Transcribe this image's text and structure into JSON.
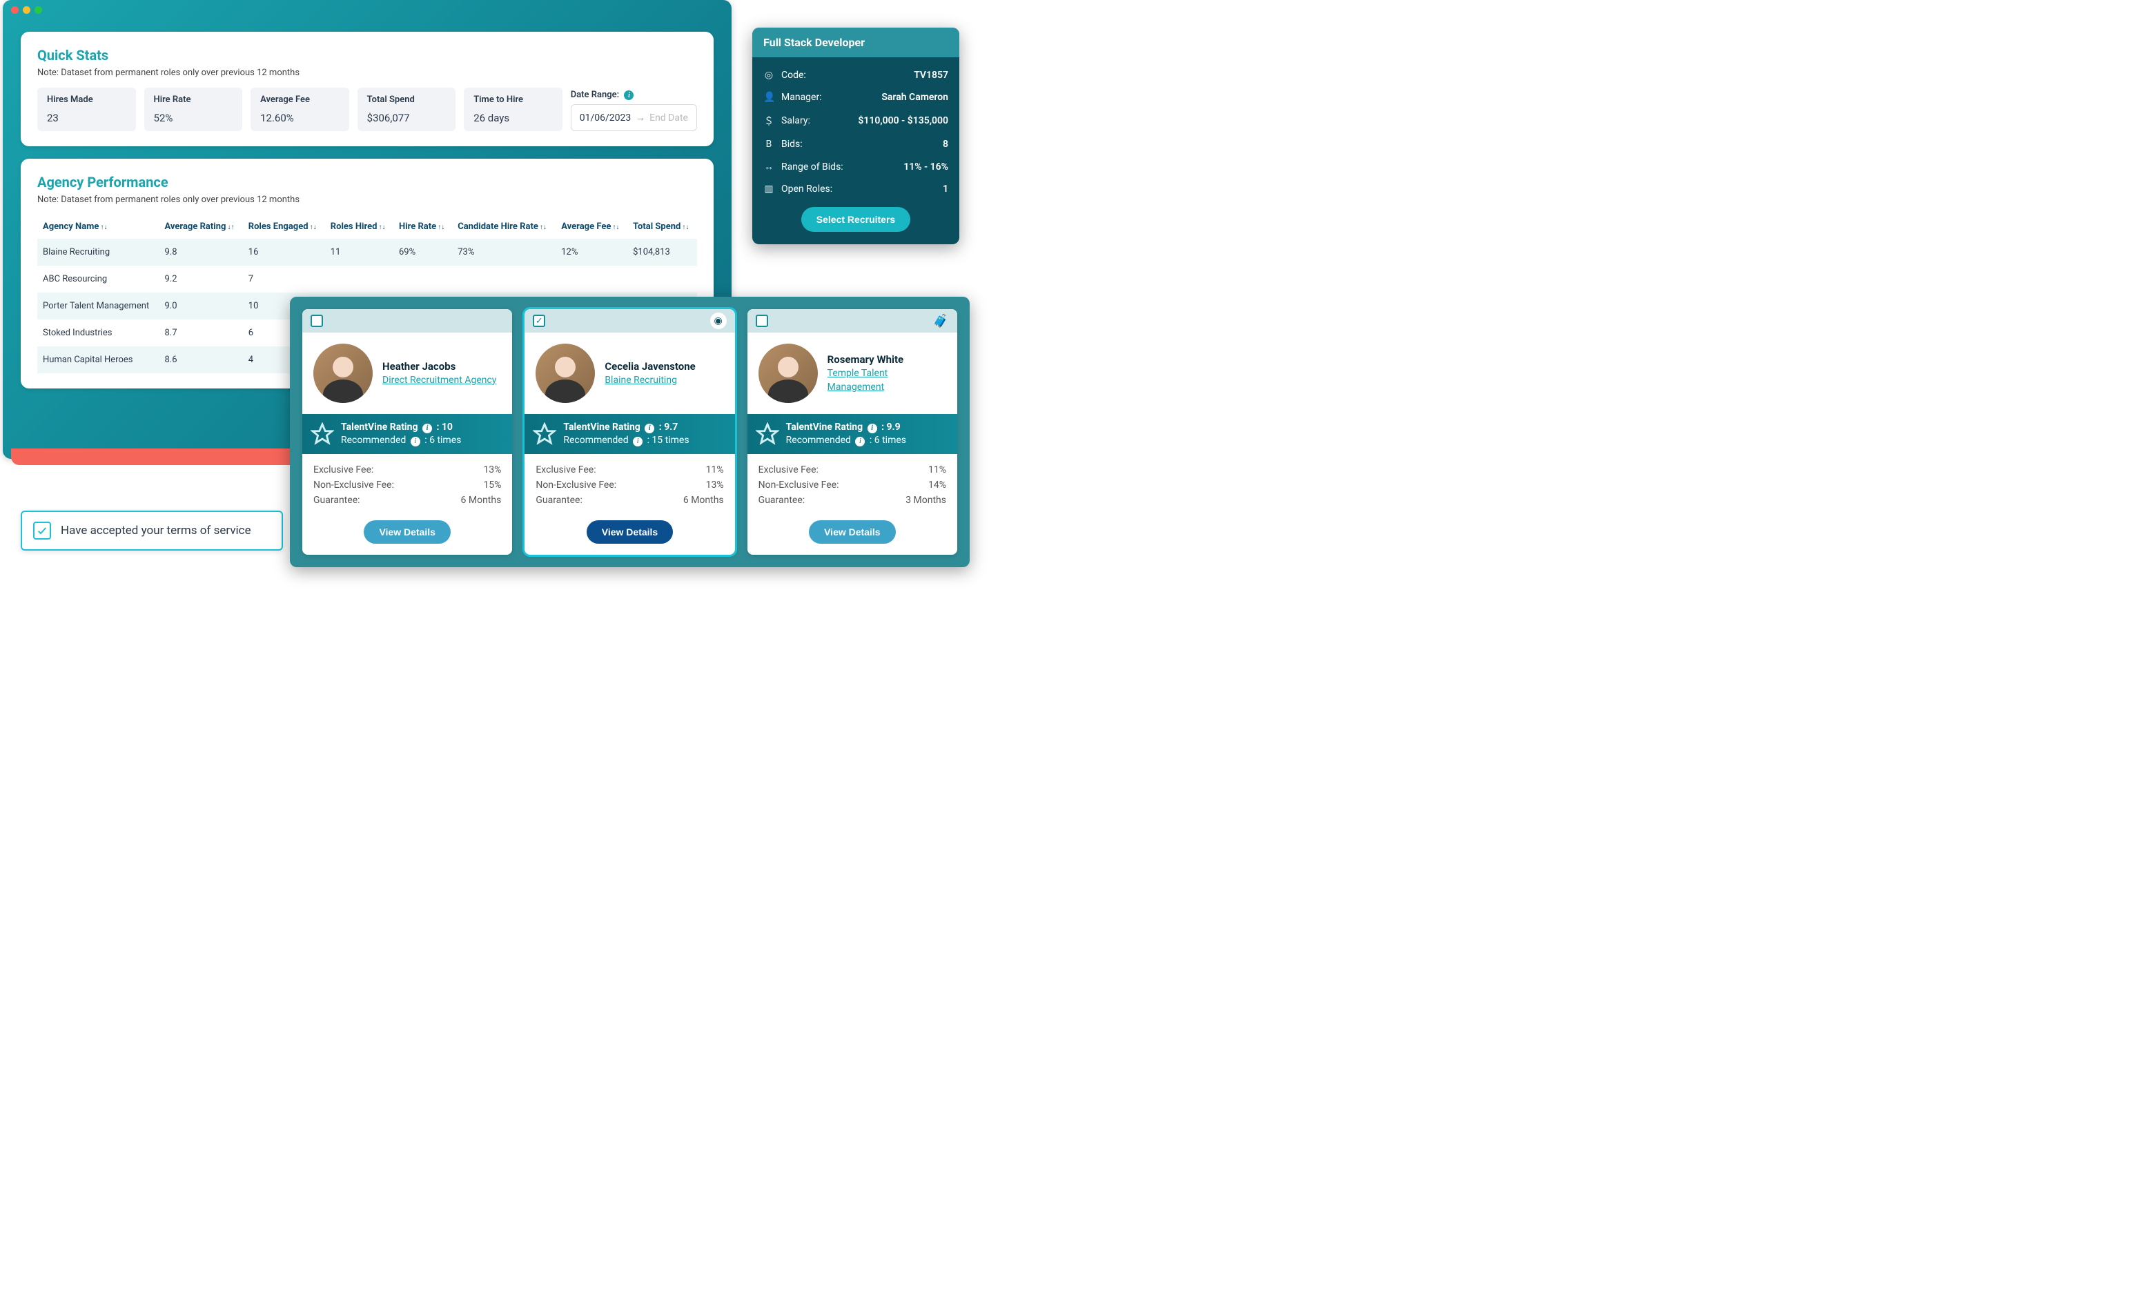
{
  "quick_stats": {
    "title": "Quick Stats",
    "note": "Note: Dataset from permanent roles only over previous 12 months",
    "items": [
      {
        "label": "Hires Made",
        "value": "23"
      },
      {
        "label": "Hire Rate",
        "value": "52%"
      },
      {
        "label": "Average Fee",
        "value": "12.60%"
      },
      {
        "label": "Total Spend",
        "value": "$306,077"
      },
      {
        "label": "Time to Hire",
        "value": "26 days"
      }
    ],
    "date_range": {
      "label": "Date Range:",
      "start": "01/06/2023",
      "end_placeholder": "End Date"
    }
  },
  "agency_perf": {
    "title": "Agency Performance",
    "note": "Note: Dataset from permanent roles only over previous 12 months",
    "columns": [
      "Agency Name",
      "Average Rating",
      "Roles Engaged",
      "Roles Hired",
      "Hire Rate",
      "Candidate Hire Rate",
      "Average Fee",
      "Total Spend"
    ],
    "rows": [
      {
        "name": "Blaine Recruiting",
        "rating": "9.8",
        "engaged": "16",
        "hired": "11",
        "hire": "69%",
        "cand": "73%",
        "fee": "12%",
        "spend": "$104,813"
      },
      {
        "name": "ABC Resourcing",
        "rating": "9.2",
        "engaged": "7",
        "hired": "",
        "hire": "",
        "cand": "",
        "fee": "",
        "spend": ""
      },
      {
        "name": "Porter Talent Management",
        "rating": "9.0",
        "engaged": "10",
        "hired": "",
        "hire": "",
        "cand": "",
        "fee": "",
        "spend": ""
      },
      {
        "name": "Stoked Industries",
        "rating": "8.7",
        "engaged": "6",
        "hired": "",
        "hire": "",
        "cand": "",
        "fee": "",
        "spend": ""
      },
      {
        "name": "Human Capital Heroes",
        "rating": "8.6",
        "engaged": "4",
        "hired": "",
        "hire": "",
        "cand": "",
        "fee": "",
        "spend": ""
      }
    ]
  },
  "role_card": {
    "title": "Full Stack Developer",
    "rows": [
      {
        "icon": "target",
        "key": "Code:",
        "val": "TV1857"
      },
      {
        "icon": "person",
        "key": "Manager:",
        "val": "Sarah Cameron"
      },
      {
        "icon": "dollar",
        "key": "Salary:",
        "val": "$110,000 - $135,000"
      },
      {
        "icon": "bold",
        "key": "Bids:",
        "val": "8"
      },
      {
        "icon": "range",
        "key": "Range of Bids:",
        "val": "11% - 16%"
      },
      {
        "icon": "book",
        "key": "Open Roles:",
        "val": "1"
      }
    ],
    "button": "Select Recruiters"
  },
  "recruiters": [
    {
      "selected": false,
      "name": "Heather Jacobs",
      "agency": "Direct Recruitment Agency",
      "rating_label": "TalentVine Rating",
      "rating_value": "10",
      "recommended_label": "Recommended",
      "recommended_value": "6 times",
      "fees": {
        "exclusive": "13%",
        "non_exclusive": "15%",
        "guarantee": "6 Months"
      },
      "button": "View Details",
      "badge": null
    },
    {
      "selected": true,
      "name": "Cecelia Javenstone",
      "agency": "Blaine Recruiting",
      "rating_label": "TalentVine Rating",
      "rating_value": "9.7",
      "recommended_label": "Recommended",
      "recommended_value": "15 times",
      "fees": {
        "exclusive": "11%",
        "non_exclusive": "13%",
        "guarantee": "6 Months"
      },
      "button": "View Details",
      "badge": "round"
    },
    {
      "selected": false,
      "name": "Rosemary White",
      "agency": "Temple Talent Management",
      "rating_label": "TalentVine Rating",
      "rating_value": "9.9",
      "recommended_label": "Recommended",
      "recommended_value": "6 times",
      "fees": {
        "exclusive": "11%",
        "non_exclusive": "14%",
        "guarantee": "3 Months"
      },
      "button": "View Details",
      "badge": "briefcase"
    }
  ],
  "fee_labels": {
    "exclusive": "Exclusive Fee:",
    "non_exclusive": "Non-Exclusive Fee:",
    "guarantee": "Guarantee:"
  },
  "terms": {
    "checked": true,
    "text": "Have accepted your terms of service"
  }
}
